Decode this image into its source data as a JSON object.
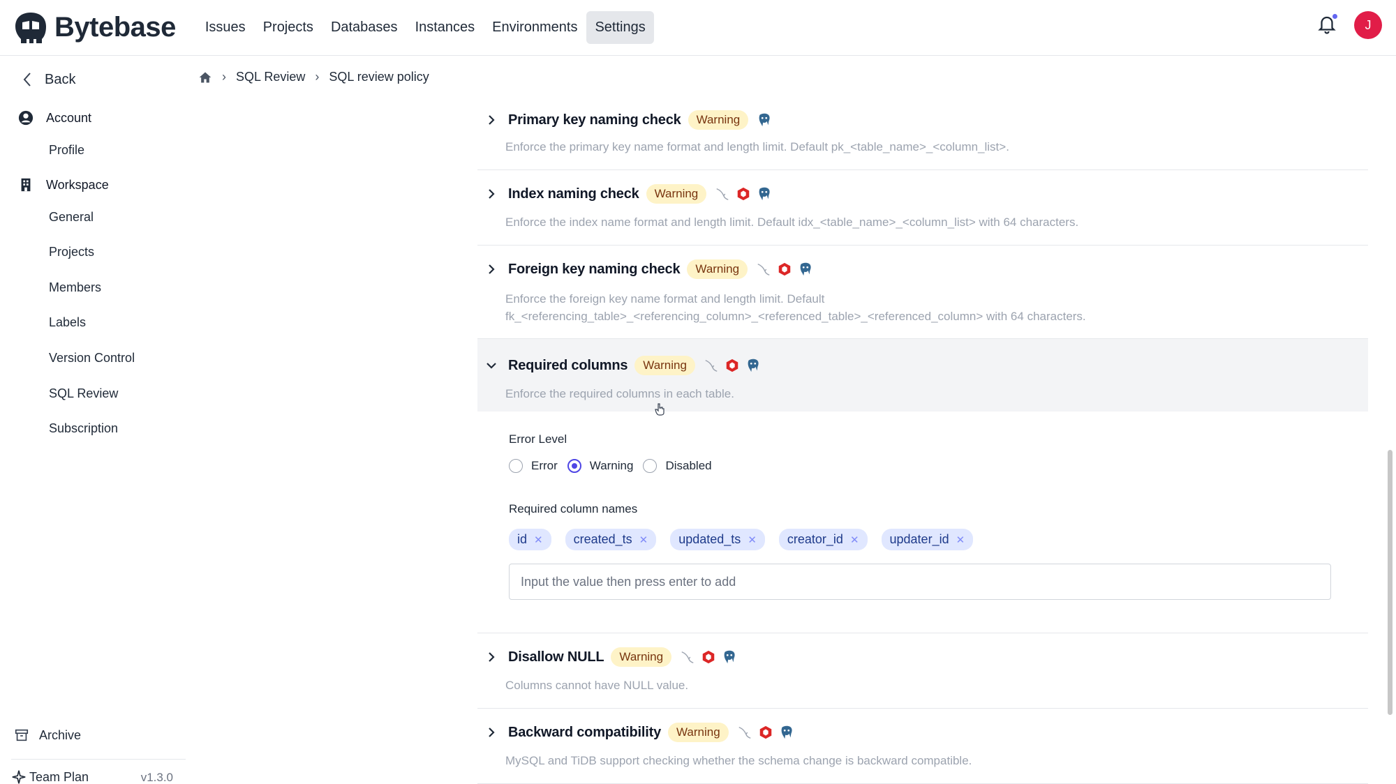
{
  "header": {
    "logo_text": "Bytebase",
    "nav": [
      "Issues",
      "Projects",
      "Databases",
      "Instances",
      "Environments",
      "Settings"
    ],
    "active_nav": "Settings",
    "avatar_initial": "J"
  },
  "sidebar": {
    "back_label": "Back",
    "account_label": "Account",
    "account_items": [
      "Profile"
    ],
    "workspace_label": "Workspace",
    "workspace_items": [
      "General",
      "Projects",
      "Members",
      "Labels",
      "Version Control",
      "SQL Review",
      "Subscription"
    ],
    "archive_label": "Archive",
    "plan_label": "Team Plan",
    "version": "v1.3.0"
  },
  "breadcrumb": {
    "items": [
      "SQL Review",
      "SQL review policy"
    ]
  },
  "rules": [
    {
      "title": "Primary key naming check",
      "level": "Warning",
      "desc1": "Enforce the primary key name format and length limit. Default pk_<table_name>_<column_list>.",
      "desc2": ""
    },
    {
      "title": "Index naming check",
      "level": "Warning",
      "desc1": "Enforce the index name format and length limit. Default idx_<table_name>_<column_list> with 64 characters.",
      "desc2": ""
    },
    {
      "title": "Foreign key naming check",
      "level": "Warning",
      "desc1": "Enforce the foreign key name format and length limit. Default",
      "desc2": "fk_<referencing_table>_<referencing_column>_<referenced_table>_<referenced_column> with 64 characters."
    },
    {
      "title": "Required columns",
      "level": "Warning",
      "desc1": "Enforce the required columns in each table.",
      "desc2": ""
    },
    {
      "title": "Disallow NULL",
      "level": "Warning",
      "desc1": "Columns cannot have NULL value.",
      "desc2": ""
    },
    {
      "title": "Backward compatibility",
      "level": "Warning",
      "desc1": "MySQL and TiDB support checking whether the schema change is backward compatible.",
      "desc2": ""
    }
  ],
  "panel": {
    "error_level_label": "Error Level",
    "options": [
      "Error",
      "Warning",
      "Disabled"
    ],
    "selected": "Warning",
    "required_columns_label": "Required column names",
    "columns": [
      "id",
      "created_ts",
      "updated_ts",
      "creator_id",
      "updater_id"
    ],
    "input_placeholder": "Input the value then press enter to add"
  },
  "colors": {
    "accent": "#4f46e5",
    "warning_bg": "#fef3c7",
    "tag_bg": "#e0e7ff",
    "avatar": "#e11d48"
  }
}
